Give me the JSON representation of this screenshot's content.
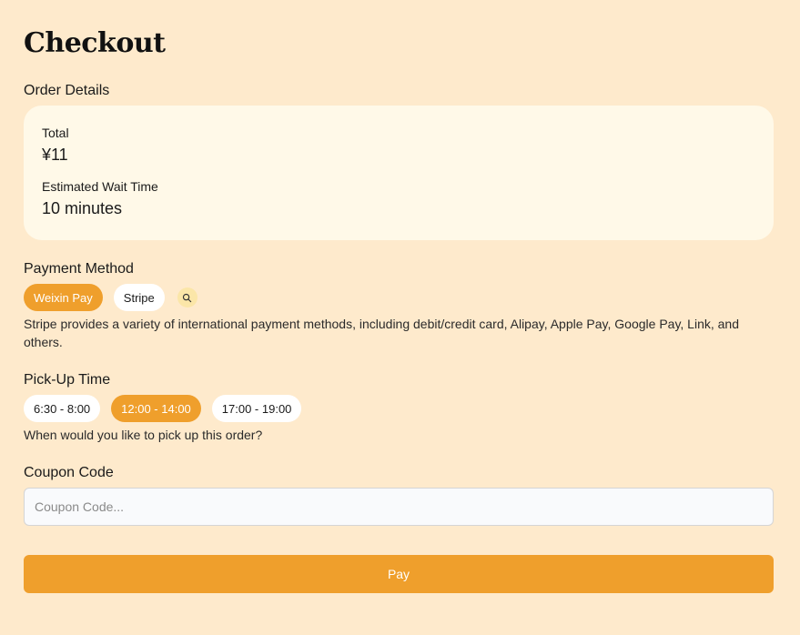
{
  "page": {
    "title": "Checkout"
  },
  "order": {
    "section_label": "Order Details",
    "total_label": "Total",
    "total_value": "¥11",
    "wait_label": "Estimated Wait Time",
    "wait_value": "10 minutes"
  },
  "payment": {
    "section_label": "Payment Method",
    "options": [
      {
        "label": "Weixin Pay",
        "selected": true
      },
      {
        "label": "Stripe",
        "selected": false
      }
    ],
    "info_icon": "magnifier-icon",
    "description": "Stripe provides a variety of international payment methods, including debit/credit card, Alipay, Apple Pay, Google Pay, Link, and others."
  },
  "pickup": {
    "section_label": "Pick-Up Time",
    "options": [
      {
        "label": "6:30 - 8:00",
        "selected": false
      },
      {
        "label": "12:00 - 14:00",
        "selected": true
      },
      {
        "label": "17:00 - 19:00",
        "selected": false
      }
    ],
    "help": "When would you like to pick up this order?"
  },
  "coupon": {
    "section_label": "Coupon Code",
    "placeholder": "Coupon Code...",
    "value": ""
  },
  "actions": {
    "pay_label": "Pay"
  },
  "colors": {
    "background": "#feeacc",
    "card": "#fff9e8",
    "accent": "#ef9f2c",
    "chip": "#ffffff",
    "icon_chip": "#fbe6a8"
  }
}
